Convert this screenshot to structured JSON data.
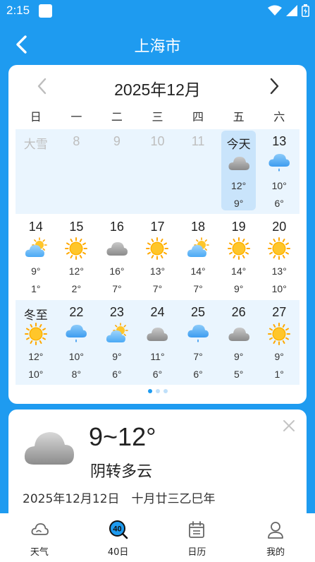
{
  "status_bar": {
    "time": "2:15"
  },
  "header": {
    "title": "上海市"
  },
  "calendar": {
    "month_title": "2025年12月",
    "weekdays": [
      "日",
      "一",
      "二",
      "三",
      "四",
      "五",
      "六"
    ],
    "weeks": [
      [
        {
          "label": "大雪",
          "state": "past"
        },
        {
          "label": "8",
          "state": "past"
        },
        {
          "label": "9",
          "state": "past"
        },
        {
          "label": "10",
          "state": "past"
        },
        {
          "label": "11",
          "state": "past"
        },
        {
          "label": "今天",
          "state": "today",
          "icon": "cloud-icon",
          "high": "12°",
          "low": "9°"
        },
        {
          "label": "13",
          "icon": "rain-icon",
          "high": "10°",
          "low": "6°"
        }
      ],
      [
        {
          "label": "14",
          "icon": "partly-cloudy-icon",
          "high": "9°",
          "low": "1°"
        },
        {
          "label": "15",
          "icon": "sun-icon",
          "high": "12°",
          "low": "2°"
        },
        {
          "label": "16",
          "icon": "cloud-icon",
          "high": "16°",
          "low": "7°"
        },
        {
          "label": "17",
          "icon": "sun-icon",
          "high": "13°",
          "low": "7°"
        },
        {
          "label": "18",
          "icon": "partly-cloudy-icon",
          "high": "14°",
          "low": "7°"
        },
        {
          "label": "19",
          "icon": "sun-icon",
          "high": "14°",
          "low": "9°"
        },
        {
          "label": "20",
          "icon": "sun-icon",
          "high": "13°",
          "low": "10°"
        }
      ],
      [
        {
          "label": "冬至",
          "icon": "sun-icon",
          "high": "12°",
          "low": "10°"
        },
        {
          "label": "22",
          "icon": "rain-icon",
          "high": "10°",
          "low": "8°"
        },
        {
          "label": "23",
          "icon": "partly-cloudy-icon",
          "high": "9°",
          "low": "6°"
        },
        {
          "label": "24",
          "icon": "cloud-icon",
          "high": "11°",
          "low": "6°"
        },
        {
          "label": "25",
          "icon": "rain-icon",
          "high": "7°",
          "low": "6°"
        },
        {
          "label": "26",
          "icon": "cloud-icon",
          "high": "9°",
          "low": "5°"
        },
        {
          "label": "27",
          "icon": "sun-icon",
          "high": "9°",
          "low": "1°"
        }
      ]
    ],
    "pager": {
      "pages": 3,
      "active": 0
    }
  },
  "detail": {
    "icon": "cloud-icon",
    "temp_range": "9~12°",
    "condition": "阴转多云",
    "date_text": "2025年12月12日　十月廿三乙巳年"
  },
  "bottom_nav": [
    {
      "label": "天气",
      "icon": "weather-icon"
    },
    {
      "label": "40日",
      "icon": "forty-day-icon",
      "badge": "40"
    },
    {
      "label": "日历",
      "icon": "calendar-icon"
    },
    {
      "label": "我的",
      "icon": "profile-icon"
    }
  ],
  "colors": {
    "brand_blue": "#1E9BF0",
    "today_highlight": "#C9E4FB",
    "row_shade": "#EAF5FE",
    "sun": "#FFA800",
    "cloud_gray": "#9E9E9E",
    "cloud_blue": "#4BA9F5"
  }
}
